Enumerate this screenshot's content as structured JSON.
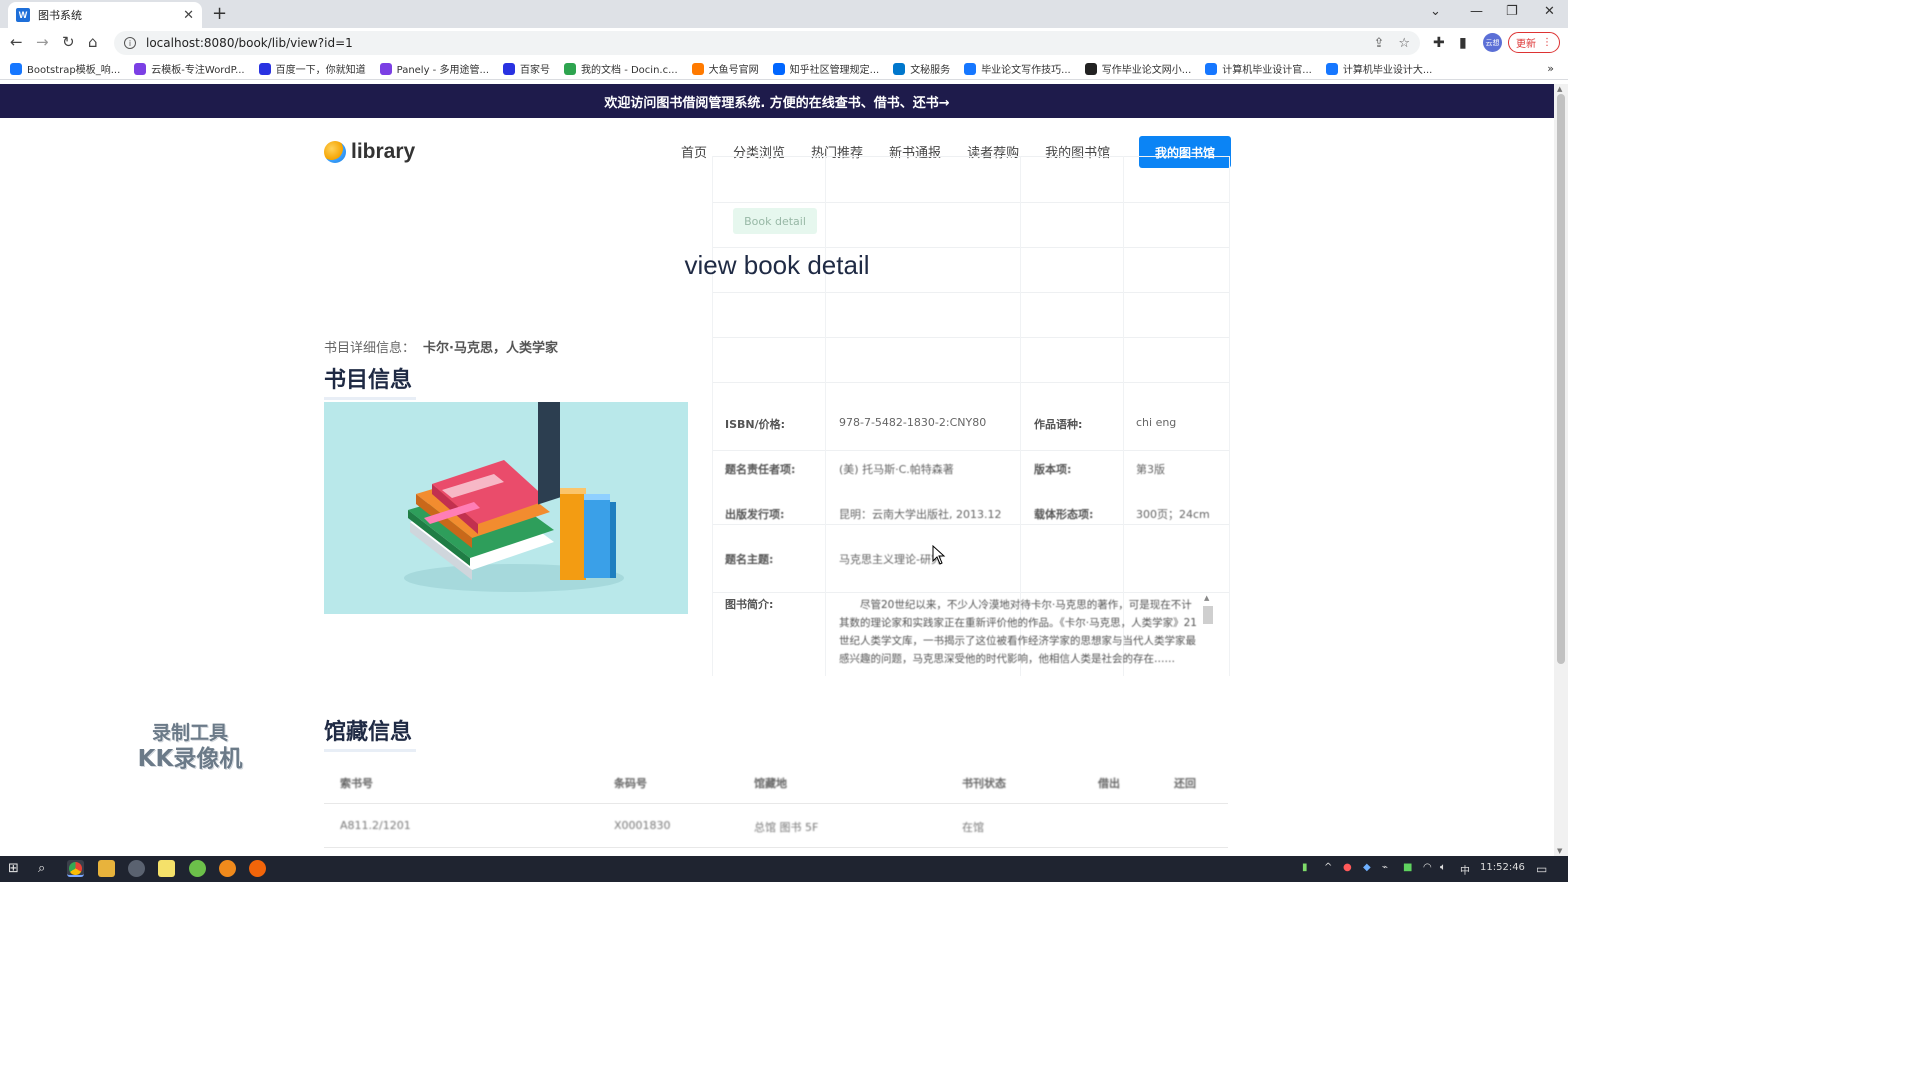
{
  "browser": {
    "tab_title": "图书系统",
    "tab_favicon": "W",
    "url": "localhost:8080/book/lib/view?id=1",
    "update_label": "更新",
    "profile_label": "云想",
    "bookmarks": [
      {
        "label": "Bootstrap模板_响...",
        "color": "#1677ff"
      },
      {
        "label": "云模板-专注WordP...",
        "color": "#7b3fe4"
      },
      {
        "label": "百度一下，你就知道",
        "color": "#2932e1"
      },
      {
        "label": "Panely - 多用途管...",
        "color": "#7b3fe4"
      },
      {
        "label": "百家号",
        "color": "#2932e1"
      },
      {
        "label": "我的文档 - Docin.c...",
        "color": "#2ea44f"
      },
      {
        "label": "大鱼号官网",
        "color": "#ff7a00"
      },
      {
        "label": "知乎社区管理规定...",
        "color": "#0066ff"
      },
      {
        "label": "文秘服务",
        "color": "#0077cc"
      },
      {
        "label": "毕业论文写作技巧...",
        "color": "#1677ff"
      },
      {
        "label": "写作毕业论文网小...",
        "color": "#222222"
      },
      {
        "label": "计算机毕业设计官...",
        "color": "#1677ff"
      },
      {
        "label": "计算机毕业设计大...",
        "color": "#1677ff"
      }
    ]
  },
  "page": {
    "banner": "欢迎访问图书借阅管理系统. 方便的在线查书、借书、还书→",
    "logo_text": "library",
    "nav": [
      "首页",
      "分类浏览",
      "热门推荐",
      "新书通报",
      "读者荐购",
      "我的图书馆"
    ],
    "mylib_button": "我的图书馆",
    "pill": "Book detail",
    "heading": "view book detail",
    "detail_label": "书目详细信息：",
    "detail_value": "卡尔·马克思，人类学家",
    "section_book": "书目信息",
    "section_holdings": "馆藏信息",
    "info": [
      {
        "k": "ISBN/价格:",
        "v": "978-7-5482-1830-2:CNY80",
        "k2": "作品语种:",
        "v2": "chi eng"
      },
      {
        "k": "题名责任者项:",
        "v": "(美) 托马斯·C.帕特森著",
        "k2": "版本项:",
        "v2": "第3版"
      },
      {
        "k": "出版发行项:",
        "v": "昆明：云南大学出版社, 2013.12",
        "k2": "载体形态项:",
        "v2": "300页；24cm"
      },
      {
        "k": "题名主题:",
        "v": "马克思主义理论-研究",
        "k2": "",
        "v2": ""
      }
    ],
    "summary_label": "图书简介:",
    "summary": "尽管20世纪以来，不少人冷漠地对待卡尔·马克思的著作，可是现在不计其数的理论家和实践家正在重新评价他的作品。《卡尔·马克思，人类学家》21世纪人类学文库，一书揭示了这位被看作经济学家的思想家与当代人类学家最感兴趣的问题，马克思深受他的时代影响，他相信人类是社会的存在……",
    "holdings_headers": [
      "索书号",
      "条码号",
      "馆藏地",
      "书刊状态",
      "借出",
      "还回"
    ],
    "holdings_rows": [
      [
        "A811.2/1201",
        "X0001830",
        "总馆 图书 5F",
        "在馆"
      ]
    ],
    "watermark_line1": "录制工具",
    "watermark_line2": "KK录像机"
  },
  "taskbar": {
    "time": "11:52:46",
    "ime": "中"
  }
}
